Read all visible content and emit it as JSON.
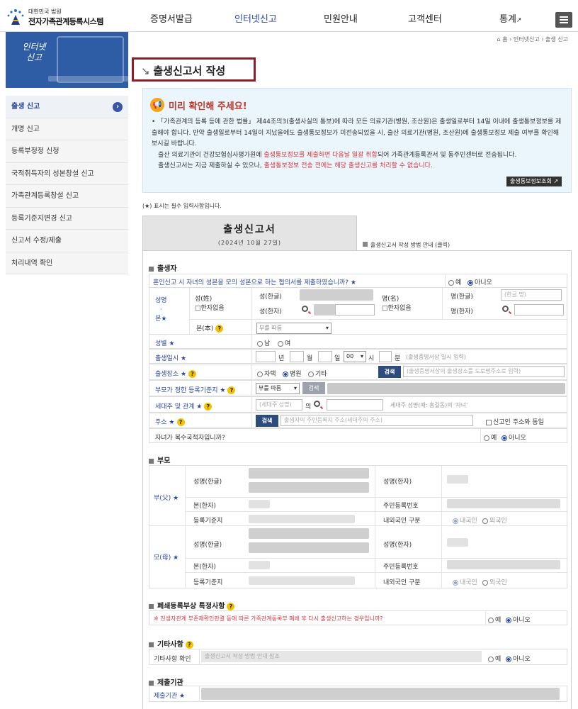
{
  "header": {
    "logo_small": "대한민국 법원",
    "logo_title": "전자가족관계등록시스템",
    "nav": [
      "증명서발급",
      "인터넷신고",
      "민원안내",
      "고객센터",
      "통계"
    ],
    "menu_icon": "hamburger-icon"
  },
  "banner": {
    "title": "인터넷\n신고"
  },
  "breadcrumb": {
    "home": "홈",
    "level1": "인터넷신고",
    "level2": "출생 신고"
  },
  "sidebar": {
    "items": [
      {
        "label": "출생 신고",
        "active": true
      },
      {
        "label": "개명 신고"
      },
      {
        "label": "등록부정정 신청"
      },
      {
        "label": "국적취득자의 성본창설 신고"
      },
      {
        "label": "가족관계등록창설 신고"
      },
      {
        "label": "등록기준지변경 신고"
      },
      {
        "label": "신고서 수정/제출"
      },
      {
        "label": "처리내역 확인"
      }
    ]
  },
  "page_title": "출생신고서 작성",
  "notice": {
    "title": "미리 확인해 주세요!",
    "p1": "「가족관계의 등록 등에 관한 법률」 제44조의3(출생사실의 통보)에 따라 모든 의료기관(병원, 조산원)은 출생일로부터 14일 이내에 출생통보정보를 제출해야 합니다. 만약 출생일로부터 14일이 지났을에도 출생통보정보가 미전송되었을 시, 출산 의료기관(병원, 조산원)에 출생통보정보 제출 여부를 확인해 보시길 바랍니다.",
    "p2a": "출산 의료기관이 건강보험심사평가원에 ",
    "p2b": "출생통보정보를 제출하면 다음날 일괄 취합",
    "p2c": "되어 가족관계등록관서 및 동주민센터로 전송됩니다.",
    "p3a": "출생신고서는 지금 제출하실 수 있으나, ",
    "p3b": "출생통보정보 전송 전에는 해당 출생신고를 처리할 수 없습니다.",
    "button": "출생통보정보조회"
  },
  "required_note": "(★) 표시는 필수 입력사항입니다.",
  "form": {
    "tab_title": "출생신고서",
    "tab_date": "(2024년 10월 27일)",
    "guide_link": "출생신고서 작성 방법 안내 (클릭)",
    "sec_child": "출생자",
    "q_agreement": "혼인신고 시 자녀의 성본을 모의 성본으로 하는 협의서를 제출하였습니까? ★",
    "yes": "예",
    "no": "아니오",
    "name_label": "성명\n·\n본★",
    "surname": "성(姓)",
    "no_hanja": "□한자없음",
    "surname_hangul": "성(한글)",
    "surname_hanja": "성(한자)",
    "given": "명(名)",
    "given_hangul": "명(한글)",
    "given_hangul_ph": "(한글 명)",
    "given_hanja": "명(한자)",
    "bon": "본(本)",
    "bon_select": "부를 따름",
    "sex": "성별 ★",
    "male": "남",
    "female": "여",
    "birth_dt": "출생일시 ★",
    "year": "년",
    "month": "월",
    "day": "일",
    "hour_sel": "00",
    "hour": "시",
    "minute": "분",
    "birth_dt_hint": "(출생증명서상 일시 입력)",
    "birth_place": "출생장소 ★",
    "home": "자택",
    "hospital": "병원",
    "etc": "기타",
    "search": "검색",
    "birth_place_ph": "(출생증명서상의 출생장소를 도로명주소로 입력)",
    "reg_base": "부모가 정한 등록기준지 ★",
    "reg_base_sel": "부를 따름",
    "household": "세대주 및 관계 ★",
    "household_ph": "(세대주 성명)",
    "of": "의",
    "relation_ph": "세대주 성명(예: 홍길동)의 '자녀'",
    "address": "주소 ★",
    "address_ph": "출생자의 주민등록지 주소(세대주의 주소)",
    "same_addr": "신고인 주소와 동일",
    "multi_nat": "자녀가 복수국적자입니까?",
    "sec_parents": "부모",
    "father": "부(父) ★",
    "mother": "모(母) ★",
    "name_hangul": "성명(한글)",
    "name_hanja": "성명(한자)",
    "bon_hanja": "본(한자)",
    "rrn": "주민등록번호",
    "reg_base2": "등록기준지",
    "nat_type": "내외국인 구분",
    "korean": "내국인",
    "foreign": "외국인",
    "sec_closed": "폐쇄등록부상 특정사항",
    "closed_q": "※ 친생자관계 부존재확인판결 등에 따른 가족관계등록부 폐쇄 후 다시 출생신고하는 경우입니까?",
    "sec_other": "기타사항",
    "other_label": "기타사항 확인",
    "other_ph": "출생신고서 작성 방법 안내 참조",
    "sec_submit": "제출기관",
    "submit_label": "제출기관 ★"
  },
  "colors": {
    "accent": "#2b4a9f",
    "title_border": "#8b1e2d",
    "notice_bg": "#eaf5fc",
    "alert": "#d9363e"
  }
}
